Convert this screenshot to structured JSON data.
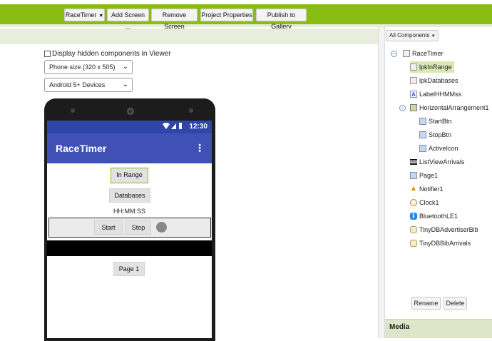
{
  "toolbar": {
    "project_label": "RaceTimer",
    "add_screen_label": "Add Screen ...",
    "remove_screen_label": "Remove Screen",
    "project_properties_label": "Project Properties",
    "publish_label": "Publish to Gallery"
  },
  "viewer": {
    "hidden_components_label": "Display hidden components in Viewer",
    "size_select": "Phone size (320 x 505)",
    "device_select": "Android 5+ Devices"
  },
  "phone": {
    "time": "12:30",
    "app_title": "RaceTimer",
    "in_range_label": "In Range",
    "databases_label": "Databases",
    "hhmmss_label": "HH:MM:SS",
    "start_label": "Start",
    "stop_label": "Stop",
    "page1_label": "Page 1"
  },
  "components": {
    "filter_label": "All Components",
    "items": [
      {
        "label": "RaceTimer",
        "icon": "screen-icon"
      },
      {
        "label": "lpkInRange",
        "icon": "listpicker-icon"
      },
      {
        "label": "lpkDatabases",
        "icon": "listpicker-icon"
      },
      {
        "label": "LabelHHMMss",
        "icon": "label-icon"
      },
      {
        "label": "HorizontalArrangement1",
        "icon": "arrangement-icon"
      },
      {
        "label": "StartBtn",
        "icon": "button-icon"
      },
      {
        "label": "StopBtn",
        "icon": "button-icon"
      },
      {
        "label": "ActiveIcon",
        "icon": "button-icon"
      },
      {
        "label": "ListViewArrivals",
        "icon": "listview-icon"
      },
      {
        "label": "Page1",
        "icon": "button-icon"
      },
      {
        "label": "Notifier1",
        "icon": "notifier-icon"
      },
      {
        "label": "Clock1",
        "icon": "clock-icon"
      },
      {
        "label": "BluetoothLE1",
        "icon": "bluetooth-icon"
      },
      {
        "label": "TinyDBAdvertiserBib",
        "icon": "tinydb-icon"
      },
      {
        "label": "TinyDBBibArrivals",
        "icon": "tinydb-icon"
      }
    ],
    "rename_label": "Rename",
    "delete_label": "Delete"
  },
  "media": {
    "title": "Media"
  },
  "colors": {
    "accent_green": "#89bd13",
    "app_bar": "#3f51b5",
    "status_bar": "#2f45a8"
  }
}
